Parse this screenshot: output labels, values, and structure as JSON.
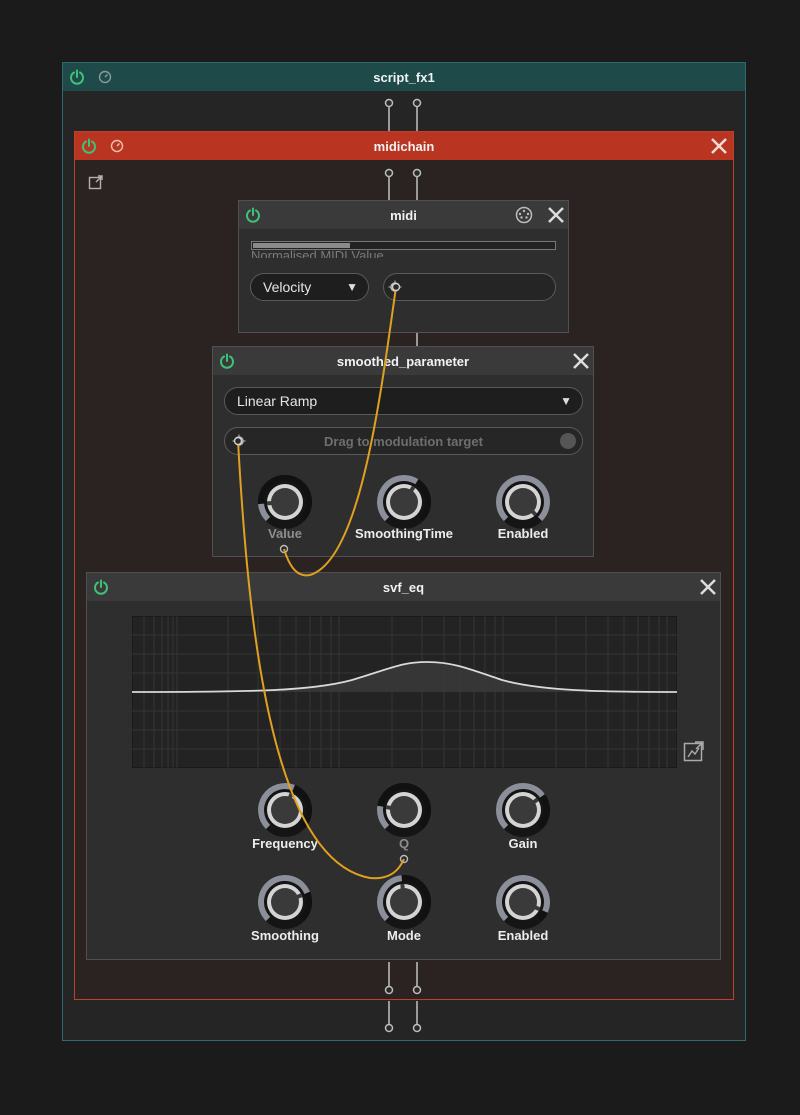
{
  "colors": {
    "background": "#1b1b1b",
    "script_header": "#1f4a4a",
    "script_border": "#2f6b6b",
    "midichain_header": "#b93522",
    "midichain_border": "#c1402c",
    "module_bg": "#2e2e2e",
    "module_header": "#3a3a3a",
    "power_on": "#3ec27a",
    "cable": "#e0a020"
  },
  "script_fx": {
    "title": "script_fx1",
    "power_icon": "power-icon",
    "bypass_icon": "bypass-icon"
  },
  "midichain": {
    "title": "midichain",
    "power_icon": "power-icon",
    "bypass_icon": "bypass-icon",
    "close_icon": "close-icon",
    "popout_icon": "popout-icon"
  },
  "midi": {
    "title": "midi",
    "slider_label": "Normalised MIDI Value",
    "slider_level": 0.32,
    "dropdown_value": "Velocity",
    "midi_icon": "midi-connector-icon",
    "close_icon": "close-icon"
  },
  "smoothed_parameter": {
    "title": "smoothed_parameter",
    "mode_value": "Linear Ramp",
    "drag_target_placeholder": "Drag to modulation target",
    "knobs": [
      {
        "label": "Value",
        "level": 0.15
      },
      {
        "label": "SmoothingTime",
        "level": 0.62
      },
      {
        "label": "Enabled",
        "level": 1.0
      }
    ]
  },
  "svf_eq": {
    "title": "svf_eq",
    "expand_icon": "expand-icon",
    "knobs_row1": [
      {
        "label": "Frequency",
        "level": 0.58
      },
      {
        "label": "Q",
        "level": 0.2
      },
      {
        "label": "Gain",
        "level": 0.7
      }
    ],
    "knobs_row2": [
      {
        "label": "Smoothing",
        "level": 0.75
      },
      {
        "label": "Mode",
        "level": 0.48
      },
      {
        "label": "Enabled",
        "level": 0.92
      }
    ]
  }
}
